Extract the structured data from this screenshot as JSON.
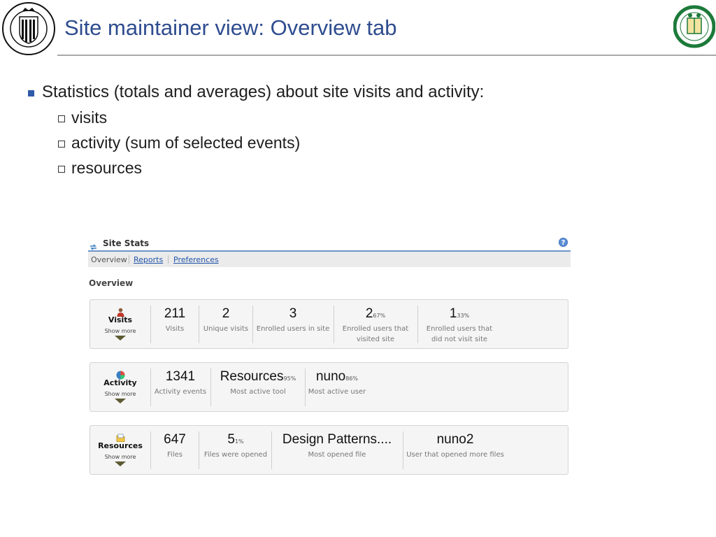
{
  "slide": {
    "title": "Site maintainer view: Overview tab",
    "left_logo": {
      "ring_text_top": "UNIVERSIDAD POLITECNICA",
      "ring_text_bottom": "VALENCIA"
    },
    "right_logo": {
      "ring_text_top": "NOVA ET NOVE",
      "ring_text_bottom": "UNIVERSIDADE FERNANDO PESSOA"
    }
  },
  "bullets": {
    "main": "Statistics (totals and averages) about site visits and activity:",
    "sub": [
      "visits",
      "activity (sum of selected events)",
      "resources"
    ]
  },
  "widget": {
    "title": "Site Stats",
    "help_icon": "?",
    "tabs": {
      "overview": "Overview",
      "reports": "Reports",
      "preferences": "Preferences"
    },
    "section_heading": "Overview",
    "show_more": "Show more",
    "visits": {
      "label": "Visits",
      "stats": [
        {
          "value": "211",
          "pct": "",
          "label": "Visits"
        },
        {
          "value": "2",
          "pct": "",
          "label": "Unique visits"
        },
        {
          "value": "3",
          "pct": "",
          "label": "Enrolled users in site"
        },
        {
          "value": "2",
          "pct": "67%",
          "label": "Enrolled users that",
          "label2": "visited site"
        },
        {
          "value": "1",
          "pct": "33%",
          "label": "Enrolled users that",
          "label2": "did not visit site"
        }
      ]
    },
    "activity": {
      "label": "Activity",
      "stats": [
        {
          "value": "1341",
          "pct": "",
          "label": "Activity events"
        },
        {
          "value": "Resources",
          "pct": "95%",
          "label": "Most active tool"
        },
        {
          "value": "nuno",
          "pct": "86%",
          "label": "Most active user"
        }
      ]
    },
    "resources": {
      "label": "Resources",
      "stats": [
        {
          "value": "647",
          "pct": "",
          "label": "Files"
        },
        {
          "value": "5",
          "pct": "1%",
          "label": "Files were opened"
        },
        {
          "value": "Design Patterns....",
          "pct": "",
          "label": "Most opened file"
        },
        {
          "value": "nuno2",
          "pct": "",
          "label": "User that opened more files"
        }
      ]
    },
    "colors": {
      "tab_rule": "#6c95c9",
      "link": "#2255aa",
      "title": "#2e4c8f",
      "bullet": "#2e5aa8"
    }
  }
}
